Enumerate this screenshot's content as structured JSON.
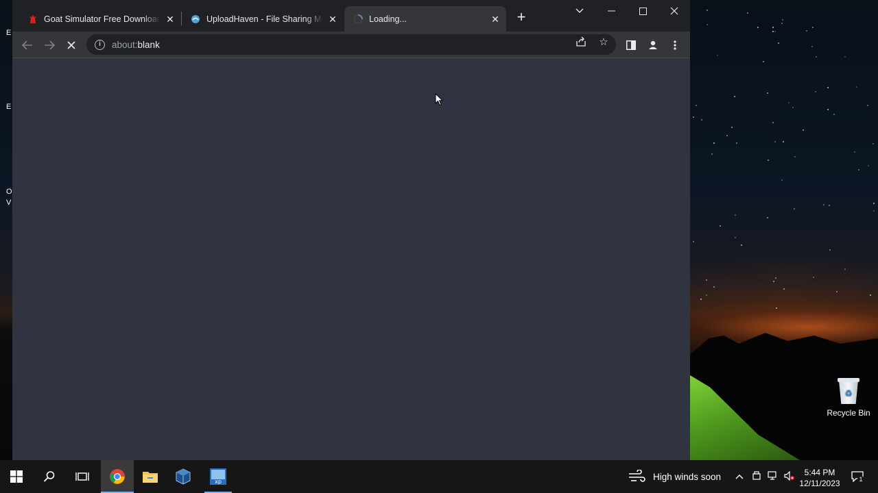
{
  "browser": {
    "tabs": [
      {
        "title": "Goat Simulator Free Download (",
        "icon": "goat-simulator-favicon"
      },
      {
        "title": "UploadHaven - File Sharing Made",
        "icon": "uploadhaven-favicon"
      },
      {
        "title": "Loading...",
        "icon": "loading-spinner"
      }
    ],
    "address": {
      "scheme": "about:",
      "path": "blank"
    }
  },
  "desktop": {
    "recycle_bin_label": "Recycle Bin",
    "left_edge_text": [
      "E",
      "E",
      "O",
      "V"
    ]
  },
  "taskbar": {
    "weather": "High winds soon",
    "time": "5:44 PM",
    "date": "12/11/2023",
    "notification_count": "1"
  },
  "colors": {
    "tabstrip": "#202124",
    "toolbar": "#35363a",
    "page_background": "#2f3440",
    "taskbar": "#161616",
    "accent": "#7cb4f2"
  }
}
